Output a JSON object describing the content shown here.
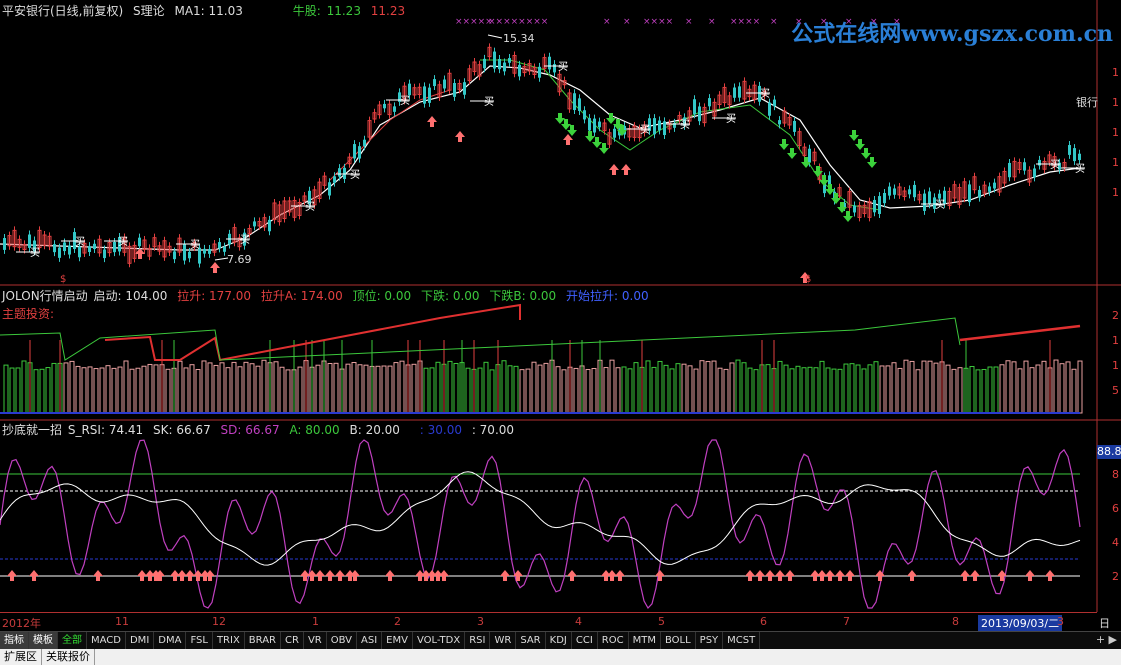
{
  "main_header": {
    "stock": "平安银行(日线,前复权)",
    "indicator": "S理论",
    "ma": "MA1: 11.03",
    "bull_label": "牛股:",
    "bull_val1": "11.23",
    "bull_val2": "11.23"
  },
  "watermark": "公式在线网www.gszx.com.cn",
  "main_chart": {
    "high_label": "15.34",
    "low_label": "7.69",
    "buy_marker": "买",
    "stock_tag": "银行",
    "dollar_marker": "$",
    "right_axis_marker": "1"
  },
  "panel2_header": {
    "name": "JOLON行情启动",
    "start": "启动: 104.00",
    "rise": "拉升: 177.00",
    "rise_a": "拉升A: 174.00",
    "top": "顶位: 0.00",
    "drop": "下跌: 0.00",
    "drop_b": "下跌B: 0.00",
    "start_rise": "开始拉升: 0.00",
    "theme": "主题投资:"
  },
  "panel2_axis": [
    "2",
    "1",
    "1",
    "5"
  ],
  "panel3_header": {
    "name": "抄底就一招",
    "s_rsi": "S_RSI: 74.41",
    "sk": "SK: 66.67",
    "sd": "SD: 66.67",
    "a": "A: 80.00",
    "b": "B: 20.00",
    "c": ": 30.00",
    "d": ": 70.00"
  },
  "panel3_axis": [
    "8",
    "6",
    "4",
    "2"
  ],
  "panel3_current": "88.8",
  "xaxis": {
    "labels": [
      "2012年",
      "11",
      "12",
      "1",
      "2",
      "3",
      "4",
      "5",
      "6",
      "7",
      "8",
      "3"
    ],
    "cursor_date": "2013/09/03/二",
    "right_end": "日线"
  },
  "tabs": [
    "指标",
    "模板",
    "全部",
    "MACD",
    "DMI",
    "DMA",
    "FSL",
    "TRIX",
    "BRAR",
    "CR",
    "VR",
    "OBV",
    "ASI",
    "EMV",
    "VOL-TDX",
    "RSI",
    "WR",
    "SAR",
    "KDJ",
    "CCI",
    "ROC",
    "MTM",
    "BOLL",
    "PSY",
    "MCST"
  ],
  "bottom_tabs": [
    "扩展区",
    "关联报价"
  ],
  "right_tools": "+ ▶",
  "colors": {
    "up": "#e24040",
    "down": "#33c8c8",
    "ma": "#ffffff",
    "green_line": "#3cc83c",
    "magenta": "#c040c0",
    "accent_blue": "#2a7fd6"
  }
}
